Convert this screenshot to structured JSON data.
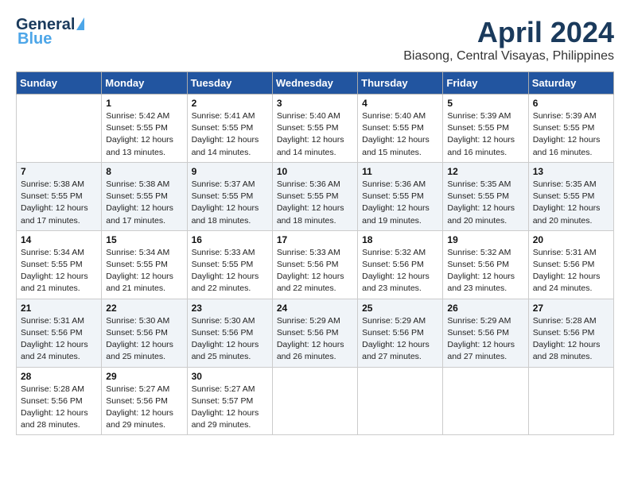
{
  "header": {
    "logo_line1": "General",
    "logo_line2": "Blue",
    "month_title": "April 2024",
    "location": "Biasong, Central Visayas, Philippines"
  },
  "calendar": {
    "days_of_week": [
      "Sunday",
      "Monday",
      "Tuesday",
      "Wednesday",
      "Thursday",
      "Friday",
      "Saturday"
    ],
    "weeks": [
      [
        {
          "num": "",
          "info": ""
        },
        {
          "num": "1",
          "info": "Sunrise: 5:42 AM\nSunset: 5:55 PM\nDaylight: 12 hours\nand 13 minutes."
        },
        {
          "num": "2",
          "info": "Sunrise: 5:41 AM\nSunset: 5:55 PM\nDaylight: 12 hours\nand 14 minutes."
        },
        {
          "num": "3",
          "info": "Sunrise: 5:40 AM\nSunset: 5:55 PM\nDaylight: 12 hours\nand 14 minutes."
        },
        {
          "num": "4",
          "info": "Sunrise: 5:40 AM\nSunset: 5:55 PM\nDaylight: 12 hours\nand 15 minutes."
        },
        {
          "num": "5",
          "info": "Sunrise: 5:39 AM\nSunset: 5:55 PM\nDaylight: 12 hours\nand 16 minutes."
        },
        {
          "num": "6",
          "info": "Sunrise: 5:39 AM\nSunset: 5:55 PM\nDaylight: 12 hours\nand 16 minutes."
        }
      ],
      [
        {
          "num": "7",
          "info": "Sunrise: 5:38 AM\nSunset: 5:55 PM\nDaylight: 12 hours\nand 17 minutes."
        },
        {
          "num": "8",
          "info": "Sunrise: 5:38 AM\nSunset: 5:55 PM\nDaylight: 12 hours\nand 17 minutes."
        },
        {
          "num": "9",
          "info": "Sunrise: 5:37 AM\nSunset: 5:55 PM\nDaylight: 12 hours\nand 18 minutes."
        },
        {
          "num": "10",
          "info": "Sunrise: 5:36 AM\nSunset: 5:55 PM\nDaylight: 12 hours\nand 18 minutes."
        },
        {
          "num": "11",
          "info": "Sunrise: 5:36 AM\nSunset: 5:55 PM\nDaylight: 12 hours\nand 19 minutes."
        },
        {
          "num": "12",
          "info": "Sunrise: 5:35 AM\nSunset: 5:55 PM\nDaylight: 12 hours\nand 20 minutes."
        },
        {
          "num": "13",
          "info": "Sunrise: 5:35 AM\nSunset: 5:55 PM\nDaylight: 12 hours\nand 20 minutes."
        }
      ],
      [
        {
          "num": "14",
          "info": "Sunrise: 5:34 AM\nSunset: 5:55 PM\nDaylight: 12 hours\nand 21 minutes."
        },
        {
          "num": "15",
          "info": "Sunrise: 5:34 AM\nSunset: 5:55 PM\nDaylight: 12 hours\nand 21 minutes."
        },
        {
          "num": "16",
          "info": "Sunrise: 5:33 AM\nSunset: 5:55 PM\nDaylight: 12 hours\nand 22 minutes."
        },
        {
          "num": "17",
          "info": "Sunrise: 5:33 AM\nSunset: 5:56 PM\nDaylight: 12 hours\nand 22 minutes."
        },
        {
          "num": "18",
          "info": "Sunrise: 5:32 AM\nSunset: 5:56 PM\nDaylight: 12 hours\nand 23 minutes."
        },
        {
          "num": "19",
          "info": "Sunrise: 5:32 AM\nSunset: 5:56 PM\nDaylight: 12 hours\nand 23 minutes."
        },
        {
          "num": "20",
          "info": "Sunrise: 5:31 AM\nSunset: 5:56 PM\nDaylight: 12 hours\nand 24 minutes."
        }
      ],
      [
        {
          "num": "21",
          "info": "Sunrise: 5:31 AM\nSunset: 5:56 PM\nDaylight: 12 hours\nand 24 minutes."
        },
        {
          "num": "22",
          "info": "Sunrise: 5:30 AM\nSunset: 5:56 PM\nDaylight: 12 hours\nand 25 minutes."
        },
        {
          "num": "23",
          "info": "Sunrise: 5:30 AM\nSunset: 5:56 PM\nDaylight: 12 hours\nand 25 minutes."
        },
        {
          "num": "24",
          "info": "Sunrise: 5:29 AM\nSunset: 5:56 PM\nDaylight: 12 hours\nand 26 minutes."
        },
        {
          "num": "25",
          "info": "Sunrise: 5:29 AM\nSunset: 5:56 PM\nDaylight: 12 hours\nand 27 minutes."
        },
        {
          "num": "26",
          "info": "Sunrise: 5:29 AM\nSunset: 5:56 PM\nDaylight: 12 hours\nand 27 minutes."
        },
        {
          "num": "27",
          "info": "Sunrise: 5:28 AM\nSunset: 5:56 PM\nDaylight: 12 hours\nand 28 minutes."
        }
      ],
      [
        {
          "num": "28",
          "info": "Sunrise: 5:28 AM\nSunset: 5:56 PM\nDaylight: 12 hours\nand 28 minutes."
        },
        {
          "num": "29",
          "info": "Sunrise: 5:27 AM\nSunset: 5:56 PM\nDaylight: 12 hours\nand 29 minutes."
        },
        {
          "num": "30",
          "info": "Sunrise: 5:27 AM\nSunset: 5:57 PM\nDaylight: 12 hours\nand 29 minutes."
        },
        {
          "num": "",
          "info": ""
        },
        {
          "num": "",
          "info": ""
        },
        {
          "num": "",
          "info": ""
        },
        {
          "num": "",
          "info": ""
        }
      ]
    ]
  }
}
